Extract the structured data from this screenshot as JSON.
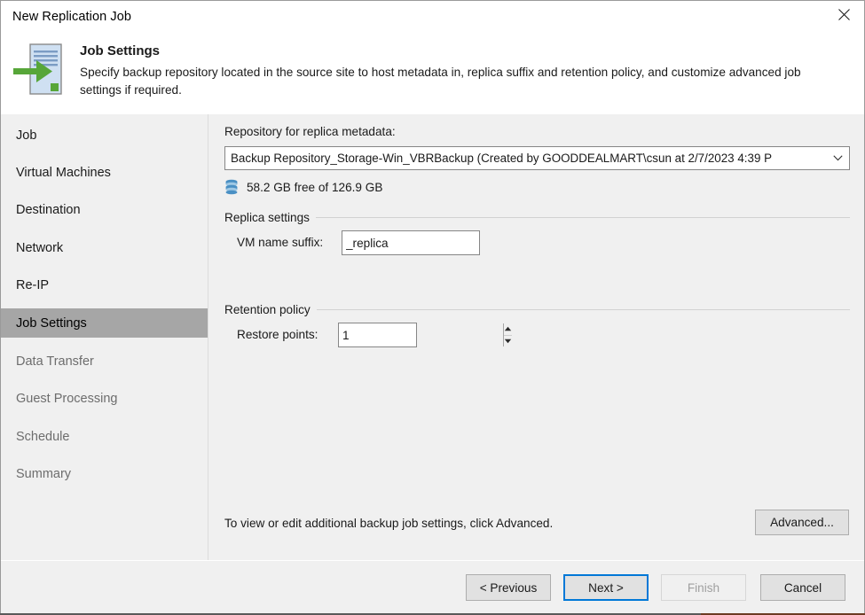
{
  "window": {
    "title": "New Replication Job",
    "close_icon": "close-icon"
  },
  "header": {
    "icon": "replication-job-icon",
    "title": "Job Settings",
    "description": "Specify backup repository located in the source site to host metadata in, replica suffix and retention policy, and customize advanced job settings if required."
  },
  "sidebar": {
    "items": [
      {
        "label": "Job",
        "state": "enabled"
      },
      {
        "label": "Virtual Machines",
        "state": "enabled"
      },
      {
        "label": "Destination",
        "state": "enabled"
      },
      {
        "label": "Network",
        "state": "enabled"
      },
      {
        "label": "Re-IP",
        "state": "enabled"
      },
      {
        "label": "Job Settings",
        "state": "active"
      },
      {
        "label": "Data Transfer",
        "state": "disabled"
      },
      {
        "label": "Guest Processing",
        "state": "disabled"
      },
      {
        "label": "Schedule",
        "state": "disabled"
      },
      {
        "label": "Summary",
        "state": "disabled"
      }
    ]
  },
  "content": {
    "repository": {
      "label": "Repository for replica metadata:",
      "selected": "Backup Repository_Storage-Win_VBRBackup (Created by GOODDEALMART\\csun at 2/7/2023 4:39 P",
      "dropdown_icon": "chevron-down-icon",
      "free_space": "58.2 GB free of 126.9 GB",
      "free_space_icon": "disk-stack-icon"
    },
    "replica_settings": {
      "group_label": "Replica settings",
      "suffix_label": "VM name suffix:",
      "suffix_value": "_replica",
      "suffix_placeholder": ""
    },
    "retention_policy": {
      "group_label": "Retention policy",
      "restore_points_label": "Restore points:",
      "restore_points_value": "1",
      "spinner_up_icon": "spinner-up-icon",
      "spinner_down_icon": "spinner-down-icon"
    },
    "advanced": {
      "hint": "To view or edit additional backup job settings, click Advanced.",
      "button_label": "Advanced..."
    }
  },
  "footer": {
    "previous_label": "< Previous",
    "next_label": "Next >",
    "finish_label": "Finish",
    "cancel_label": "Cancel"
  },
  "colors": {
    "accent_focus": "#0078d7",
    "window_bg": "#f0f0f0",
    "active_nav": "#a6a6a6",
    "icon_green": "#57a639",
    "icon_blue": "#4a90c4"
  }
}
